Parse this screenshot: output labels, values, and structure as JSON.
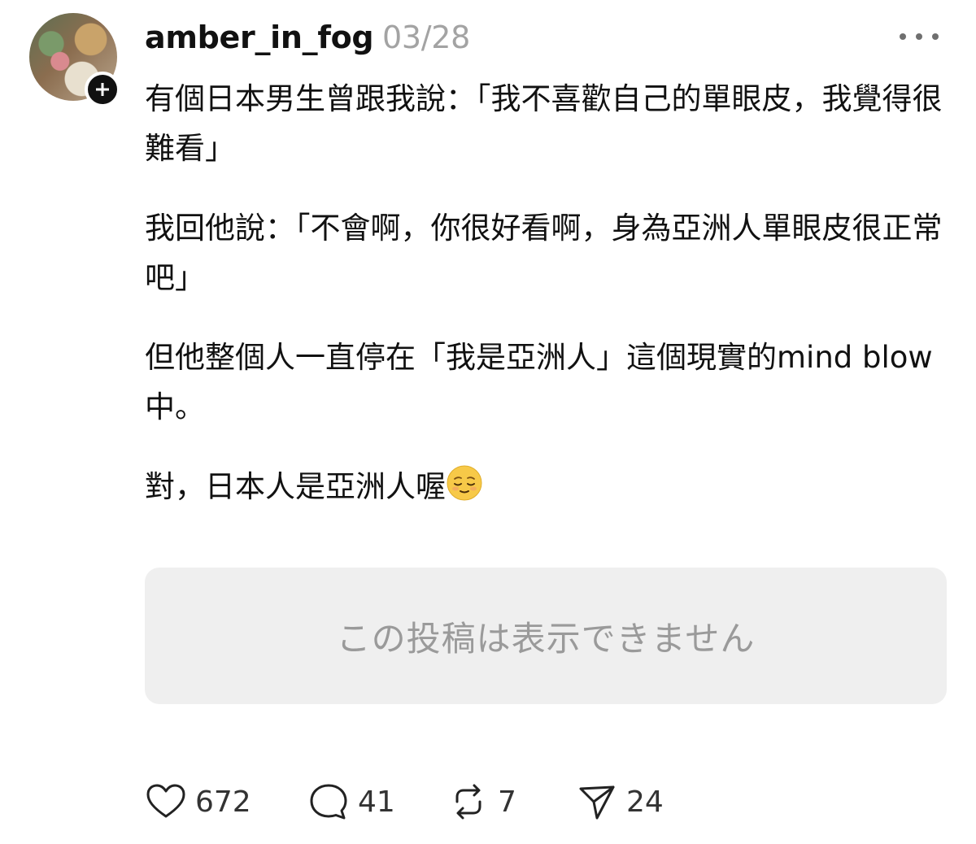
{
  "post": {
    "username": "amber_in_fog",
    "date": "03/28",
    "paragraphs": [
      "有個日本男生曾跟我說：「我不喜歡自己的單眼皮，我覺得很難看」",
      "我回他說：「不會啊，你很好看啊，身為亞洲人單眼皮很正常吧」",
      "但他整個人一直停在「我是亞洲人」這個現實的mind blow中。",
      "對，日本人是亞洲人喔"
    ],
    "last_paragraph_emoji": "relieved-face-emoji"
  },
  "quoted_post": {
    "message": "この投稿は表示できません"
  },
  "actions": {
    "likes": "672",
    "comments": "41",
    "reposts": "7",
    "shares": "24"
  },
  "icons": {
    "avatar": "profile-picture",
    "follow": "plus-icon",
    "more": "more-dots-icon",
    "like": "heart-icon",
    "comment": "comment-bubble-icon",
    "repost": "repost-icon",
    "share": "send-icon"
  },
  "colors": {
    "text": "#111111",
    "muted": "#a3a3a3",
    "placeholder_bg": "#efefef"
  }
}
